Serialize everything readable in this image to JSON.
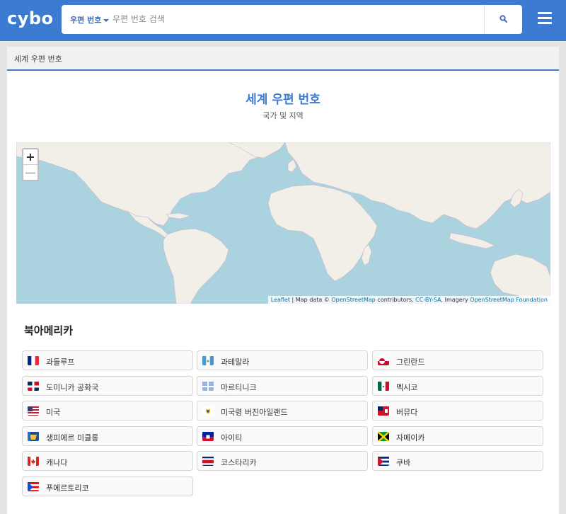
{
  "header": {
    "logo": "cybo",
    "search_scope": "우편 번호",
    "search_placeholder": "우편 번호 검색"
  },
  "breadcrumb": "세계 우편 번호",
  "title": "세계 우편 번호",
  "subtitle": "국가 및 지역",
  "map": {
    "zoom_in": "+",
    "zoom_out": "—",
    "attr_leaflet": "Leaflet",
    "attr_mapdata": " | Map data © ",
    "attr_osm": "OpenStreetMap",
    "attr_contrib": " contributors, ",
    "attr_license": "CC-BY-SA",
    "attr_imagery": ", Imagery ",
    "attr_foundation": "OpenStreetMap Foundation"
  },
  "region": "북아메리카",
  "countries": [
    {
      "name": "과들루프",
      "flag": "france"
    },
    {
      "name": "과테말라",
      "flag": "guatemala"
    },
    {
      "name": "그린란드",
      "flag": "greenland"
    },
    {
      "name": "도미니카 공화국",
      "flag": "dominican-republic"
    },
    {
      "name": "마르티니크",
      "flag": "martinique"
    },
    {
      "name": "멕시코",
      "flag": "mexico"
    },
    {
      "name": "미국",
      "flag": "usa"
    },
    {
      "name": "미국령 버진아일랜드",
      "flag": "us-virgin-islands"
    },
    {
      "name": "버뮤다",
      "flag": "bermuda"
    },
    {
      "name": "생피에르 미클롱",
      "flag": "saint-pierre-miquelon"
    },
    {
      "name": "아이티",
      "flag": "haiti"
    },
    {
      "name": "자메이카",
      "flag": "jamaica"
    },
    {
      "name": "캐나다",
      "flag": "canada"
    },
    {
      "name": "코스타리카",
      "flag": "costa-rica"
    },
    {
      "name": "쿠바",
      "flag": "cuba"
    },
    {
      "name": "푸에르토리코",
      "flag": "puerto-rico"
    }
  ],
  "colors": {
    "brand": "#3d7ad1",
    "title": "#3d7ad1",
    "map_water": "#aad3df",
    "map_land": "#f2efe9",
    "attribution_link": "#0078a8"
  }
}
